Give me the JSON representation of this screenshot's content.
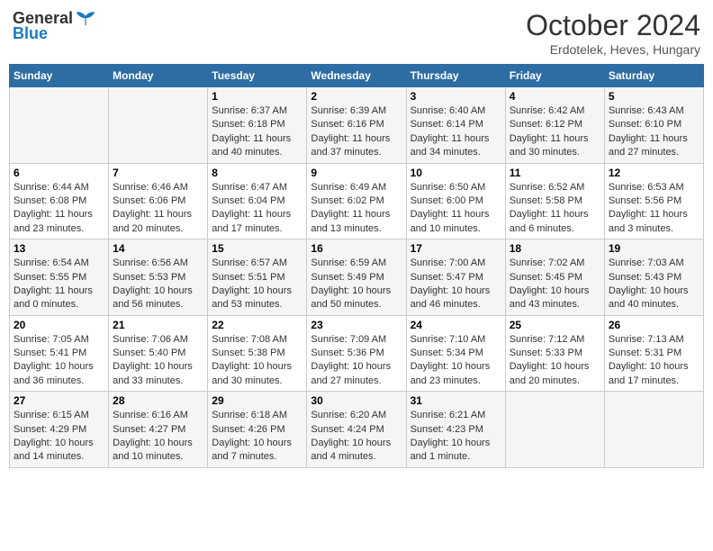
{
  "header": {
    "logo_general": "General",
    "logo_blue": "Blue",
    "month_title": "October 2024",
    "subtitle": "Erdotelek, Heves, Hungary"
  },
  "days_of_week": [
    "Sunday",
    "Monday",
    "Tuesday",
    "Wednesday",
    "Thursday",
    "Friday",
    "Saturday"
  ],
  "weeks": [
    [
      {
        "day": "",
        "info": ""
      },
      {
        "day": "",
        "info": ""
      },
      {
        "day": "1",
        "info": "Sunrise: 6:37 AM\nSunset: 6:18 PM\nDaylight: 11 hours\nand 40 minutes."
      },
      {
        "day": "2",
        "info": "Sunrise: 6:39 AM\nSunset: 6:16 PM\nDaylight: 11 hours\nand 37 minutes."
      },
      {
        "day": "3",
        "info": "Sunrise: 6:40 AM\nSunset: 6:14 PM\nDaylight: 11 hours\nand 34 minutes."
      },
      {
        "day": "4",
        "info": "Sunrise: 6:42 AM\nSunset: 6:12 PM\nDaylight: 11 hours\nand 30 minutes."
      },
      {
        "day": "5",
        "info": "Sunrise: 6:43 AM\nSunset: 6:10 PM\nDaylight: 11 hours\nand 27 minutes."
      }
    ],
    [
      {
        "day": "6",
        "info": "Sunrise: 6:44 AM\nSunset: 6:08 PM\nDaylight: 11 hours\nand 23 minutes."
      },
      {
        "day": "7",
        "info": "Sunrise: 6:46 AM\nSunset: 6:06 PM\nDaylight: 11 hours\nand 20 minutes."
      },
      {
        "day": "8",
        "info": "Sunrise: 6:47 AM\nSunset: 6:04 PM\nDaylight: 11 hours\nand 17 minutes."
      },
      {
        "day": "9",
        "info": "Sunrise: 6:49 AM\nSunset: 6:02 PM\nDaylight: 11 hours\nand 13 minutes."
      },
      {
        "day": "10",
        "info": "Sunrise: 6:50 AM\nSunset: 6:00 PM\nDaylight: 11 hours\nand 10 minutes."
      },
      {
        "day": "11",
        "info": "Sunrise: 6:52 AM\nSunset: 5:58 PM\nDaylight: 11 hours\nand 6 minutes."
      },
      {
        "day": "12",
        "info": "Sunrise: 6:53 AM\nSunset: 5:56 PM\nDaylight: 11 hours\nand 3 minutes."
      }
    ],
    [
      {
        "day": "13",
        "info": "Sunrise: 6:54 AM\nSunset: 5:55 PM\nDaylight: 11 hours\nand 0 minutes."
      },
      {
        "day": "14",
        "info": "Sunrise: 6:56 AM\nSunset: 5:53 PM\nDaylight: 10 hours\nand 56 minutes."
      },
      {
        "day": "15",
        "info": "Sunrise: 6:57 AM\nSunset: 5:51 PM\nDaylight: 10 hours\nand 53 minutes."
      },
      {
        "day": "16",
        "info": "Sunrise: 6:59 AM\nSunset: 5:49 PM\nDaylight: 10 hours\nand 50 minutes."
      },
      {
        "day": "17",
        "info": "Sunrise: 7:00 AM\nSunset: 5:47 PM\nDaylight: 10 hours\nand 46 minutes."
      },
      {
        "day": "18",
        "info": "Sunrise: 7:02 AM\nSunset: 5:45 PM\nDaylight: 10 hours\nand 43 minutes."
      },
      {
        "day": "19",
        "info": "Sunrise: 7:03 AM\nSunset: 5:43 PM\nDaylight: 10 hours\nand 40 minutes."
      }
    ],
    [
      {
        "day": "20",
        "info": "Sunrise: 7:05 AM\nSunset: 5:41 PM\nDaylight: 10 hours\nand 36 minutes."
      },
      {
        "day": "21",
        "info": "Sunrise: 7:06 AM\nSunset: 5:40 PM\nDaylight: 10 hours\nand 33 minutes."
      },
      {
        "day": "22",
        "info": "Sunrise: 7:08 AM\nSunset: 5:38 PM\nDaylight: 10 hours\nand 30 minutes."
      },
      {
        "day": "23",
        "info": "Sunrise: 7:09 AM\nSunset: 5:36 PM\nDaylight: 10 hours\nand 27 minutes."
      },
      {
        "day": "24",
        "info": "Sunrise: 7:10 AM\nSunset: 5:34 PM\nDaylight: 10 hours\nand 23 minutes."
      },
      {
        "day": "25",
        "info": "Sunrise: 7:12 AM\nSunset: 5:33 PM\nDaylight: 10 hours\nand 20 minutes."
      },
      {
        "day": "26",
        "info": "Sunrise: 7:13 AM\nSunset: 5:31 PM\nDaylight: 10 hours\nand 17 minutes."
      }
    ],
    [
      {
        "day": "27",
        "info": "Sunrise: 6:15 AM\nSunset: 4:29 PM\nDaylight: 10 hours\nand 14 minutes."
      },
      {
        "day": "28",
        "info": "Sunrise: 6:16 AM\nSunset: 4:27 PM\nDaylight: 10 hours\nand 10 minutes."
      },
      {
        "day": "29",
        "info": "Sunrise: 6:18 AM\nSunset: 4:26 PM\nDaylight: 10 hours\nand 7 minutes."
      },
      {
        "day": "30",
        "info": "Sunrise: 6:20 AM\nSunset: 4:24 PM\nDaylight: 10 hours\nand 4 minutes."
      },
      {
        "day": "31",
        "info": "Sunrise: 6:21 AM\nSunset: 4:23 PM\nDaylight: 10 hours\nand 1 minute."
      },
      {
        "day": "",
        "info": ""
      },
      {
        "day": "",
        "info": ""
      }
    ]
  ]
}
